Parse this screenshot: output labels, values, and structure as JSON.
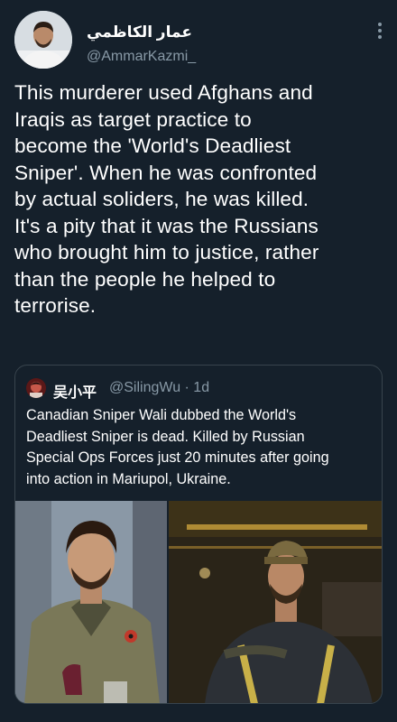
{
  "author": {
    "display_name": "عمار الكاظمي",
    "handle": "@AmmarKazmi_"
  },
  "tweet": {
    "lines": [
      "This murderer used Afghans and",
      "Iraqis as target practice to",
      "become the 'World's Deadliest",
      "Sniper'. When he was confronted",
      "by actual soliders, he was killed.",
      "It's a pity that it was the Russians",
      "who brought him to justice, rather",
      "than the people he helped to",
      "terrorise."
    ]
  },
  "quote": {
    "display_name": "吴小平",
    "handle": "@SilingWu · 1d",
    "lines": [
      "Canadian Sniper Wali dubbed the World's",
      "Deadliest Sniper is dead. Killed by Russian",
      "Special Ops Forces just 20 minutes after going",
      "into action in Mariupol, Ukraine."
    ]
  },
  "icons": {
    "more": "more-vertical-icon"
  },
  "colors": {
    "background": "#15202b",
    "secondary_text": "#8899a6",
    "border": "#38444d"
  }
}
